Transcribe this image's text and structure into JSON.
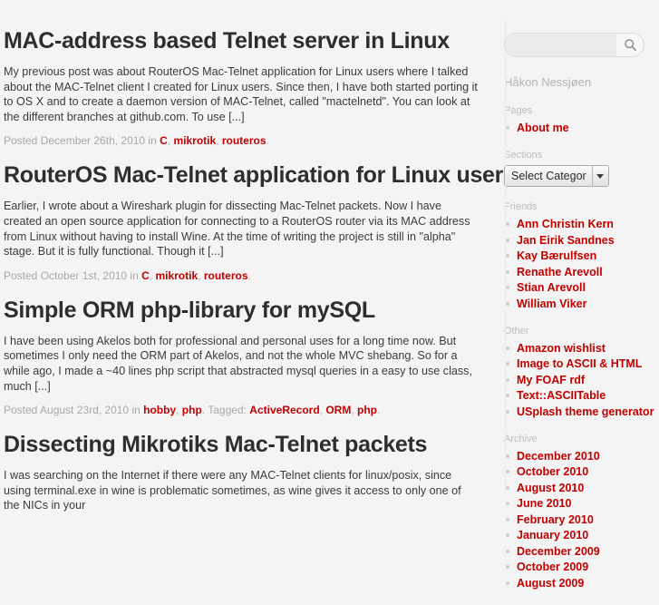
{
  "posts": [
    {
      "title": "MAC-address based Telnet server in Linux",
      "excerpt": "My previous post was about RouterOS Mac-Telnet application for Linux users where I talked about the MAC-Telnet client I created for Linux users. Since then, I have both started porting it to OS X and to create a daemon version of MAC-Telnet, called \"mactelnetd\". You can look at the different branches at github.com. To use [...]",
      "posted_prefix": "Posted December 26th, 2010 in",
      "categories": [
        "C",
        "mikrotik",
        "routeros"
      ],
      "tagged_prefix": "",
      "tags": []
    },
    {
      "title": "RouterOS Mac-Telnet application for Linux users",
      "excerpt": "Earlier, I wrote about a Wireshark plugin for dissecting Mac-Telnet packets. Now I have created an open source application for connecting to a RouterOS router via its MAC address from Linux without having to install Wine. At the time of writing the project is still in \"alpha\" stage. But it is fully functional. Though it [...]",
      "posted_prefix": "Posted October 1st, 2010 in",
      "categories": [
        "C",
        "mikrotik",
        "routeros"
      ],
      "tagged_prefix": "",
      "tags": []
    },
    {
      "title": "Simple ORM php-library for mySQL",
      "excerpt": "I have been using Akelos both for professional and personal uses for a long time now. But sometimes I only need the ORM part of Akelos, and not the whole MVC shebang. So for a while ago, I made a ~40 lines php script that abstracted mysql queries in a easy to use class, much [...]",
      "posted_prefix": "Posted August 23rd, 2010 in",
      "categories": [
        "hobby",
        "php"
      ],
      "tagged_prefix": "Tagged:",
      "tags": [
        "ActiveRecord",
        "ORM",
        "php"
      ]
    },
    {
      "title": "Dissecting Mikrotiks Mac-Telnet packets",
      "excerpt": "I was searching on the Internet if there were any MAC-Telnet clients for linux/posix, since using terminal.exe in wine is problematic sometimes, as wine gives it access to only one of the NICs in your",
      "posted_prefix": "",
      "categories": [],
      "tagged_prefix": "",
      "tags": []
    }
  ],
  "sidebar": {
    "search": {
      "value": "",
      "placeholder": "",
      "button_icon": "search-icon"
    },
    "author": "Håkon Nessjøen",
    "widgets": [
      {
        "title": "Pages",
        "type": "links",
        "items": [
          "About me"
        ]
      },
      {
        "title": "Sections",
        "type": "select",
        "selected": "Select Categor",
        "items": []
      },
      {
        "title": "Friends",
        "type": "links",
        "items": [
          "Ann Christin Kern",
          "Jan Eirik Sandnes",
          "Kay Bærulfsen",
          "Renathe Arevoll",
          "Stian Arevoll",
          "William Viker"
        ]
      },
      {
        "title": "Other",
        "type": "links",
        "items": [
          "Amazon wishlist",
          "Image to ASCII & HTML",
          "My FOAF rdf",
          "Text::ASCIITable",
          "USplash theme generator"
        ]
      },
      {
        "title": "Archive",
        "type": "links",
        "items": [
          "December 2010",
          "October 2010",
          "August 2010",
          "June 2010",
          "February 2010",
          "January 2010",
          "December 2009",
          "October 2009",
          "August 2009"
        ]
      }
    ]
  },
  "colors": {
    "link_red": "#c30000",
    "page_bg": "#f4f4f4",
    "title": "#2e2e2e",
    "muted": "#a8a8a8"
  }
}
